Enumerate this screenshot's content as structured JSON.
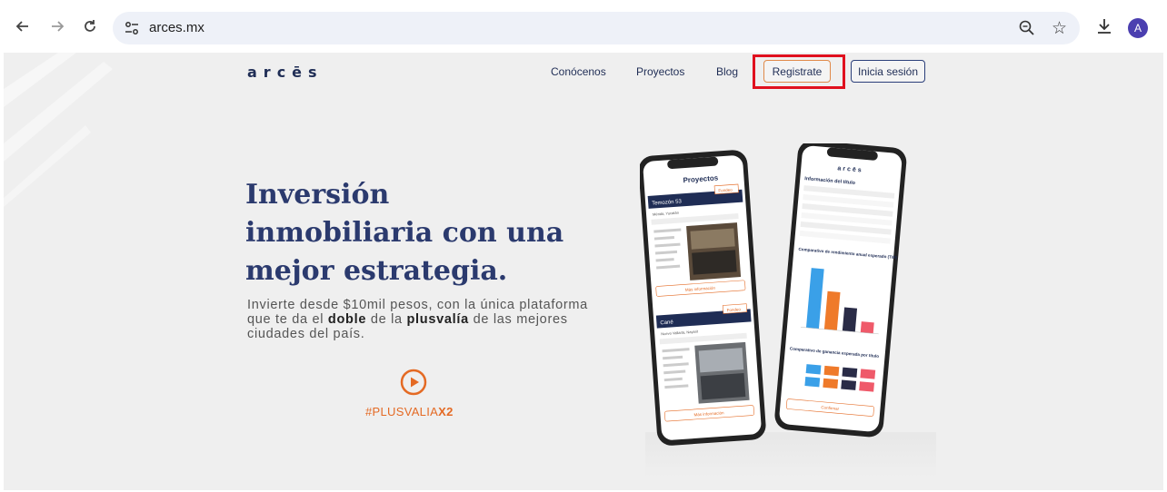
{
  "browser": {
    "url": "arces.mx",
    "avatar_letter": "A",
    "icons": [
      "back-arrow-icon",
      "forward-arrow-icon",
      "reload-icon",
      "site-settings-icon",
      "zoom-icon",
      "star-icon",
      "download-icon"
    ]
  },
  "site": {
    "logo": "arcēs",
    "nav": {
      "conocenos": "Conócenos",
      "proyectos": "Proyectos",
      "blog": "Blog",
      "register": "Registrate",
      "login": "Inicia sesión"
    },
    "hero": {
      "title_line1": "Inversión",
      "title_line2": "inmobiliaria con una",
      "title_line3": "mejor estrategia.",
      "sub_part1": "Invierte desde $10mil pesos, con la única plataforma que te da el ",
      "sub_bold1": "doble",
      "sub_part2": " de la ",
      "sub_bold2": "plusvalía",
      "sub_part3": " de las mejores ciudades del país.",
      "hashtag_prefix": "#PLUSVALIA",
      "hashtag_bold": "X2"
    },
    "phone_left": {
      "header": "Proyectos",
      "card1_title": "Temozón 53",
      "card1_badge": "Fondeo",
      "card1_city": "Mérida, Yucatán",
      "card1_button": "Más información",
      "card2_title": "Cané",
      "card2_badge": "Fondeo",
      "card2_city": "Nuevo Vallarta, Nayarit",
      "card2_button": "Más información"
    },
    "phone_right": {
      "logo": "arcēs",
      "section1": "Información del título",
      "section2": "Comparativo de rendimiento anual esperado (TIR)",
      "section3": "Comparativo de ganancia esperada por título",
      "button": "Confirmar"
    },
    "colors": {
      "brand_navy": "#1f2d55",
      "accent_orange": "#e46a24",
      "highlight_red": "#e0101e"
    }
  }
}
